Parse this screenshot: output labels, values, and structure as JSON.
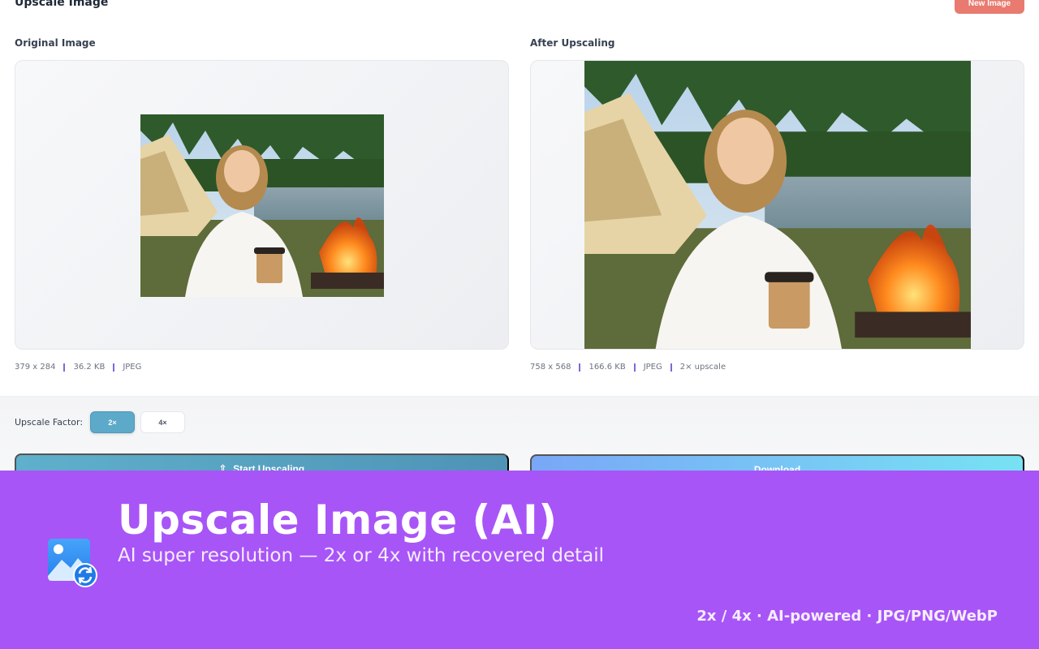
{
  "header": {
    "title": "Upscale Image",
    "new_image_label": "New Image"
  },
  "original": {
    "label": "Original Image",
    "dimensions": "379 x 284",
    "size": "36.2 KB",
    "format": "JPEG"
  },
  "upscaled": {
    "label": "After Upscaling",
    "dimensions": "758 x 568",
    "size": "166.6 KB",
    "format": "JPEG",
    "factor_note": "2× upscale"
  },
  "controls": {
    "factor_label": "Upscale Factor:",
    "factors": [
      "2×",
      "4×"
    ],
    "selected_factor": "2×",
    "start_label": "Start Upscaling",
    "start_icon": "upload-arrow-icon",
    "download_label": "Download"
  },
  "banner": {
    "title": "Upscale Image (AI)",
    "subtitle": "AI super resolution — 2x or 4x with recovered detail",
    "tags": "2x / 4x · AI-powered · JPG/PNG/WebP",
    "icon": "image-refresh-icon"
  },
  "colors": {
    "banner_bg": "#a855f7",
    "new_image_btn": "#e87a6f",
    "factor_active": "#5da9c9",
    "start_btn": "#4f93b6",
    "download_btn_start": "#79a7f6",
    "download_btn_end": "#77e2f3",
    "meta_separator": "#7c6ad6"
  }
}
